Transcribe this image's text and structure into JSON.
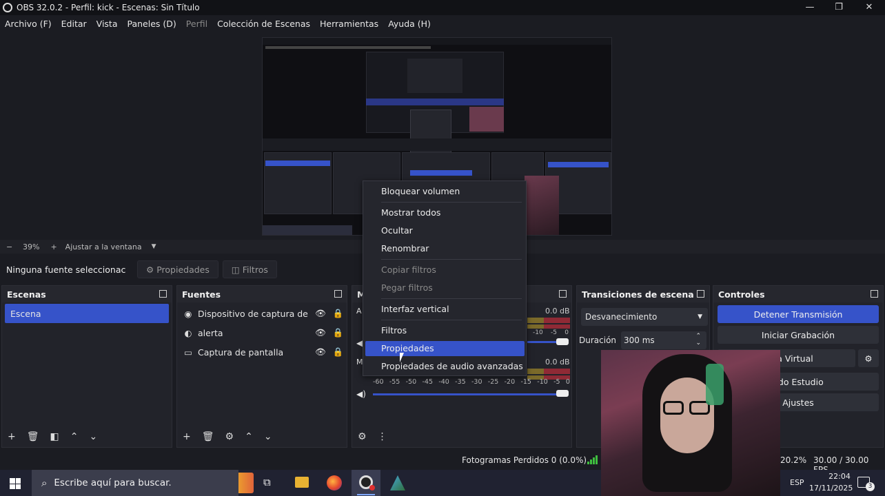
{
  "window": {
    "title": "OBS 32.0.2 - Perfil: kick - Escenas: Sin Título",
    "controls": [
      "—",
      "❐",
      "✕"
    ]
  },
  "menu": {
    "items": [
      {
        "label": "Archivo (F)",
        "enabled": true
      },
      {
        "label": "Editar",
        "enabled": true
      },
      {
        "label": "Vista",
        "enabled": true
      },
      {
        "label": "Paneles (D)",
        "enabled": true
      },
      {
        "label": "Perfil",
        "enabled": false
      },
      {
        "label": "Colección de Escenas",
        "enabled": true
      },
      {
        "label": "Herramientas",
        "enabled": true
      },
      {
        "label": "Ayuda (H)",
        "enabled": true
      }
    ]
  },
  "zoom": {
    "minus": "−",
    "value": "39%",
    "plus": "+",
    "fit_label": "Ajustar a la ventana"
  },
  "source_bar": {
    "no_source": "Ninguna fuente seleccionac",
    "properties": "Propiedades",
    "filters": "Filtros"
  },
  "scenes": {
    "title": "Escenas",
    "items": [
      "Escena"
    ],
    "selected": 0
  },
  "sources": {
    "title": "Fuentes",
    "items": [
      {
        "label": "Dispositivo de captura de vid",
        "icon": "camera-icon"
      },
      {
        "label": "alerta",
        "icon": "browser-icon"
      },
      {
        "label": "Captura de pantalla",
        "icon": "monitor-icon"
      }
    ]
  },
  "mixer": {
    "title": "M",
    "track1_db": "0.0 dB",
    "track2_db": "0.0 dB",
    "scale": [
      "-60",
      "-55",
      "-50",
      "-45",
      "-40",
      "-35",
      "-30",
      "-25",
      "-20",
      "-15",
      "-10",
      "-5",
      "0"
    ],
    "scale_partial": [
      "-10",
      "-5",
      "0"
    ],
    "track1_label": "A",
    "track2_label": "M"
  },
  "context_menu": {
    "items": [
      {
        "label": "Bloquear volumen",
        "enabled": true
      },
      {
        "label": "Mostrar todos",
        "enabled": true
      },
      {
        "label": "Ocultar",
        "enabled": true
      },
      {
        "label": "Renombrar",
        "enabled": true
      },
      {
        "label": "Copiar filtros",
        "enabled": false
      },
      {
        "label": "Pegar filtros",
        "enabled": false
      },
      {
        "label": "Interfaz vertical",
        "enabled": true
      },
      {
        "label": "Filtros",
        "enabled": true
      },
      {
        "label": "Propiedades",
        "enabled": true,
        "highlighted": true
      },
      {
        "label": "Propiedades de audio avanzadas",
        "enabled": true
      }
    ]
  },
  "transitions": {
    "title": "Transiciones de escena",
    "selected": "Desvanecimiento",
    "duration_label": "Duración",
    "duration_value": "300 ms"
  },
  "controls": {
    "title": "Controles",
    "stop_stream": "Detener Transmisión",
    "start_recording": "Iniciar Grabación",
    "virtual_cam": "mara Virtual",
    "studio_mode": "odo Estudio",
    "settings": "Ajustes"
  },
  "status": {
    "dropped_frames": "Fotogramas Perdidos 0 (0.0%)",
    "cpu": "20.2%",
    "fps": "30.00 / 30.00 FPS"
  },
  "taskbar": {
    "search_placeholder": "Escribe aquí para buscar.",
    "lang": "ESP",
    "time": "22:04",
    "date": "17/11/2025",
    "notif_count": "3"
  },
  "colors": {
    "accent": "#3653c9",
    "background": "#1b1c22",
    "dock": "#22232a",
    "meter_green": "#3c8f3c",
    "meter_red": "#8f2a35"
  }
}
